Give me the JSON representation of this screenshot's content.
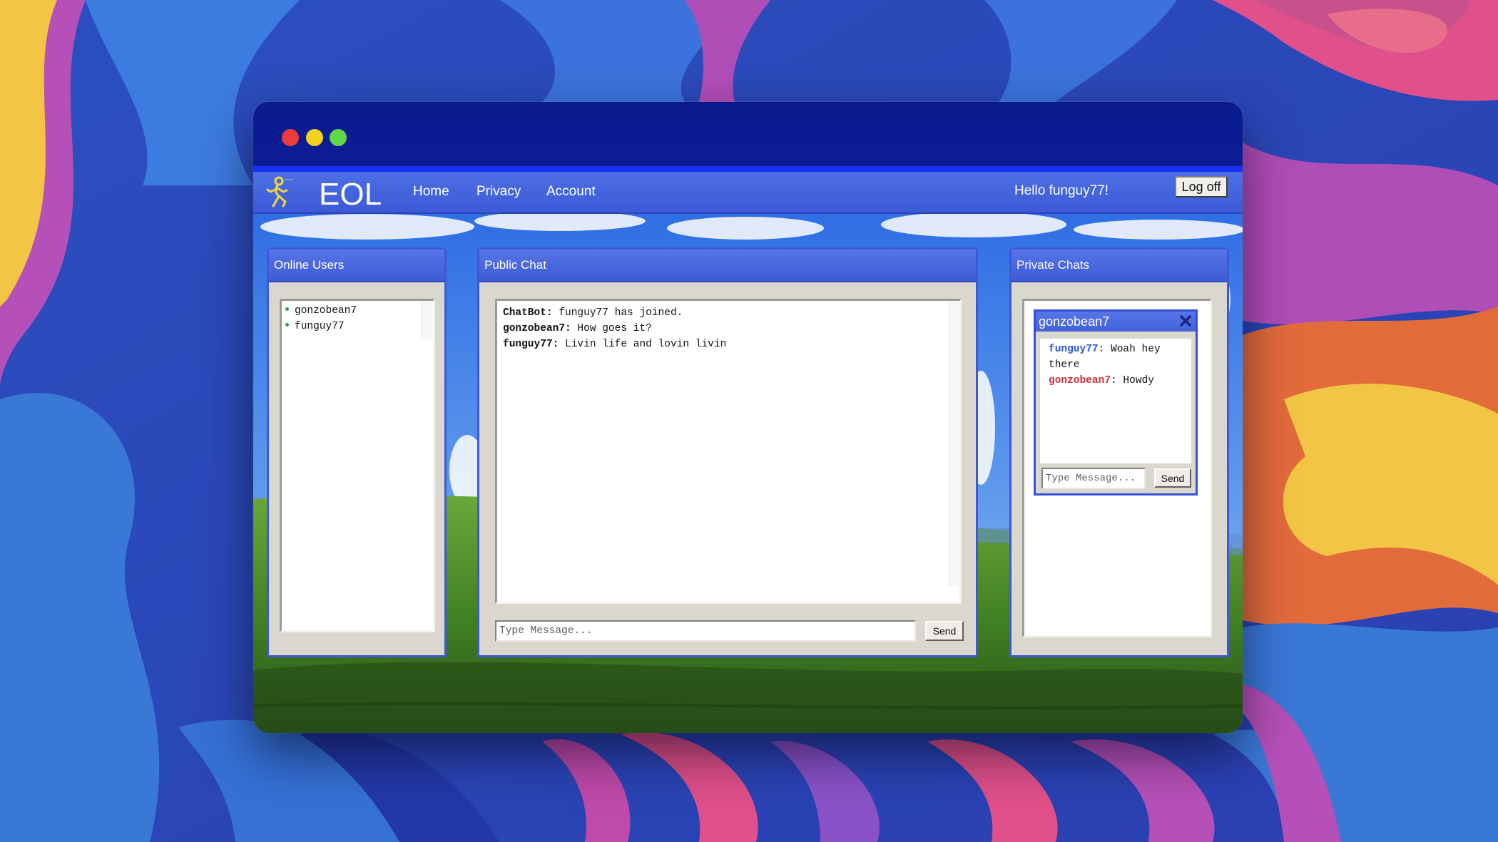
{
  "app": {
    "brand": "EOL"
  },
  "nav": {
    "links": [
      "Home",
      "Privacy",
      "Account"
    ],
    "greeting": "Hello funguy77!",
    "logoff_label": "Log off"
  },
  "online_users": {
    "title": "Online Users",
    "users": [
      "gonzobean7",
      "funguy77"
    ]
  },
  "public_chat": {
    "title": "Public Chat",
    "messages": [
      {
        "sender": "ChatBot",
        "sep": ":",
        "text": " funguy77 has joined."
      },
      {
        "sender": "gonzobean7",
        "sep": ":",
        "text": " How goes it?"
      },
      {
        "sender": "funguy77",
        "sep": ":",
        "text": " Livin life and lovin livin"
      }
    ],
    "input_placeholder": "Type Message...",
    "send_label": "Send"
  },
  "private_chats": {
    "title": "Private Chats",
    "window": {
      "title": "gonzobean7",
      "messages": [
        {
          "sender": "funguy77",
          "line1": ": Woah hey",
          "line2": "there"
        },
        {
          "sender": "gonzobean7",
          "line1": ": Howdy"
        }
      ],
      "input_placeholder": "Type Message...",
      "send_label": "Send"
    }
  },
  "colors": {
    "titlebar": "#0c1d95",
    "nav": "#4466df",
    "panel_border": "#3f58d8",
    "sender_self": "#2a56d6",
    "sender_other": "#c9323f"
  },
  "icons": [
    "running-man-logo-icon",
    "close-icon"
  ]
}
